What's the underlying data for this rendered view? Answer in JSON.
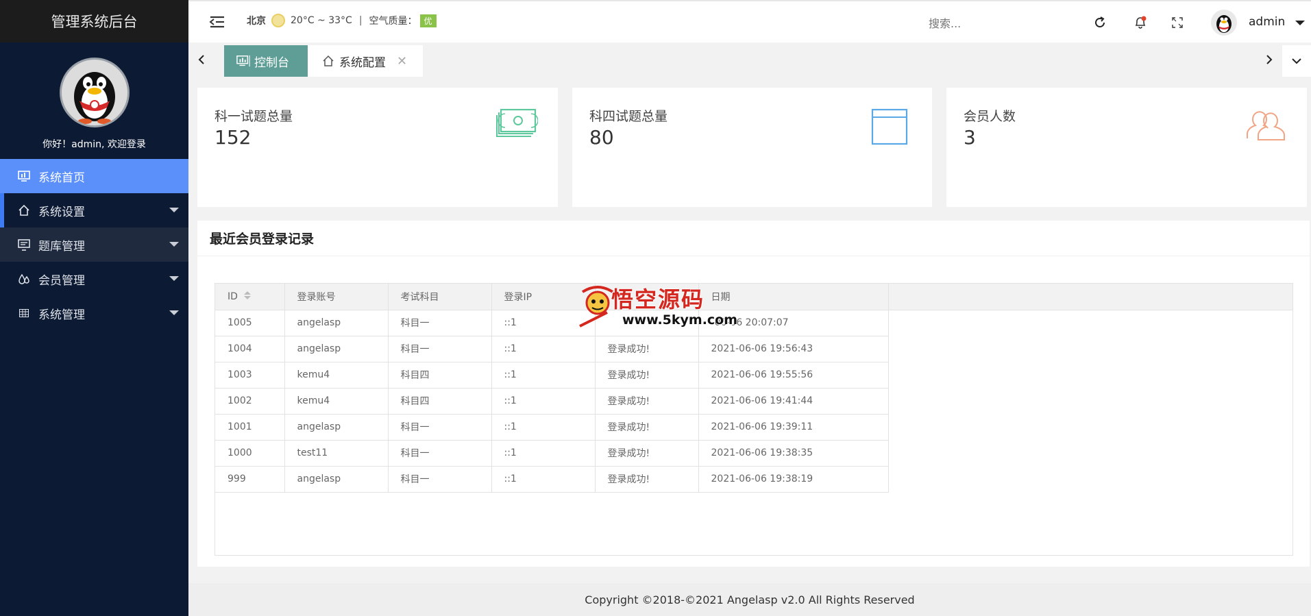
{
  "app": {
    "title": "管理系统后台"
  },
  "sidebar": {
    "welcome": "你好！admin, 欢迎登录",
    "items": [
      {
        "label": "系统首页",
        "icon": "monitor-icon",
        "active": true
      },
      {
        "label": "系统设置",
        "icon": "home-icon"
      },
      {
        "label": "题库管理",
        "icon": "screen-icon"
      },
      {
        "label": "会员管理",
        "icon": "drops-icon"
      },
      {
        "label": "系统管理",
        "icon": "grid-icon"
      }
    ]
  },
  "header": {
    "city": "北京",
    "temperature": "20°C ~ 33°C",
    "separator": "|",
    "air_quality_label": "空气质量：",
    "air_quality_value": "优",
    "search_placeholder": "搜索...",
    "user_name": "admin"
  },
  "tabs": [
    {
      "label": "控制台",
      "icon": "dashboard-icon",
      "active": true
    },
    {
      "label": "系统配置",
      "icon": "home-icon",
      "closable": true,
      "close_glyph": "✕"
    }
  ],
  "stats": [
    {
      "title": "科一试题总量",
      "value": "152",
      "icon": "money-icon",
      "color": "#5cc89b"
    },
    {
      "title": "科四试题总量",
      "value": "80",
      "icon": "browser-window-icon",
      "color": "#5aa9e6"
    },
    {
      "title": "会员人数",
      "value": "3",
      "icon": "users-icon",
      "color": "#f0a585"
    }
  ],
  "records": {
    "title": "最近会员登录记录",
    "columns": [
      "ID",
      "登录账号",
      "考试科目",
      "登录IP",
      "",
      "日期"
    ],
    "rows": [
      [
        "1005",
        "angelasp",
        "科目一",
        "::1",
        "",
        "-06-06 20:07:07"
      ],
      [
        "1004",
        "angelasp",
        "科目一",
        "::1",
        "登录成功!",
        "2021-06-06 19:56:43"
      ],
      [
        "1003",
        "kemu4",
        "科目四",
        "::1",
        "登录成功!",
        "2021-06-06 19:55:56"
      ],
      [
        "1002",
        "kemu4",
        "科目四",
        "::1",
        "登录成功!",
        "2021-06-06 19:41:44"
      ],
      [
        "1001",
        "angelasp",
        "科目一",
        "::1",
        "登录成功!",
        "2021-06-06 19:39:11"
      ],
      [
        "1000",
        "test11",
        "科目一",
        "::1",
        "登录成功!",
        "2021-06-06 19:38:35"
      ],
      [
        "999",
        "angelasp",
        "科目一",
        "::1",
        "登录成功!",
        "2021-06-06 19:38:19"
      ]
    ]
  },
  "watermark": {
    "title": "悟空源码",
    "url": "www.5kym.com"
  },
  "footer": {
    "copyright": "Copyright ©2018-©2021 Angelasp v2.0 All Rights Reserved"
  },
  "colors": {
    "sidebar_bg": "#0d1a33",
    "active_menu": "#5b8ff9",
    "active_tab": "#5f9e96",
    "aq_badge": "#8bc34a"
  }
}
